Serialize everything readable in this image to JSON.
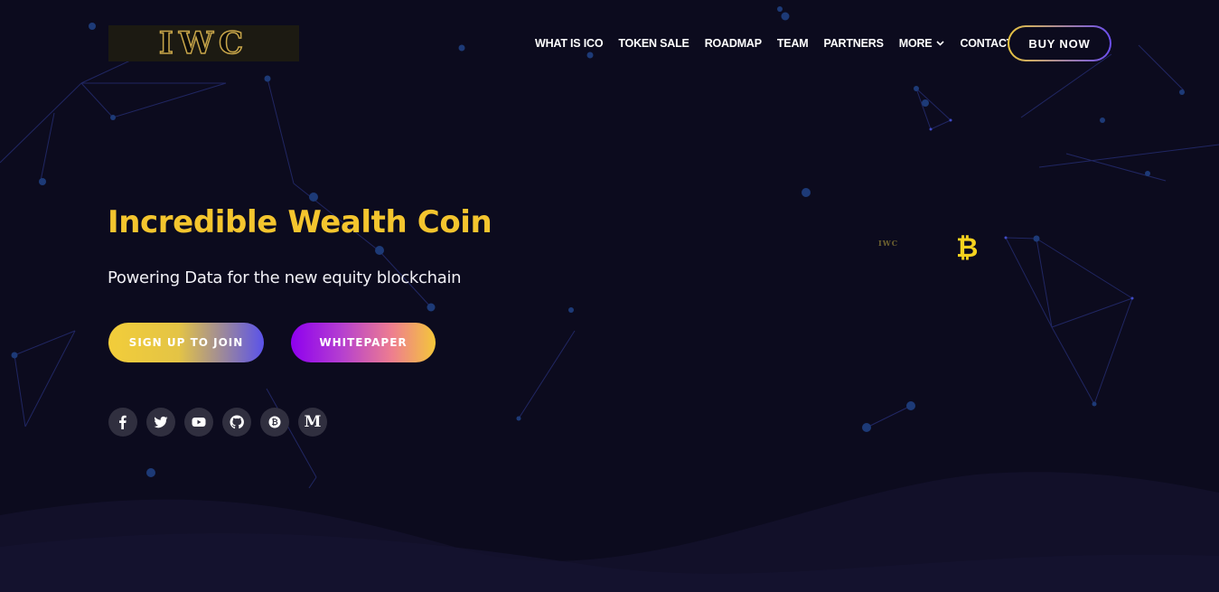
{
  "brand": {
    "logo_text": "IWC",
    "mini_logo_text": "IWC"
  },
  "nav": {
    "items": [
      {
        "label": "WHAT IS ICO"
      },
      {
        "label": "TOKEN SALE"
      },
      {
        "label": "ROADMAP"
      },
      {
        "label": "TEAM"
      },
      {
        "label": "PARTNERS"
      },
      {
        "label": "MORE",
        "has_dropdown": true
      },
      {
        "label": "CONTACT"
      }
    ],
    "buy_label": "BUY NOW"
  },
  "hero": {
    "title": "Incredible Wealth Coin",
    "subtitle": "Powering Data for the new equity blockchain",
    "signup_label": "SIGN UP TO JOIN",
    "whitepaper_label": "WHITEPAPER"
  },
  "socials": [
    {
      "icon": "facebook-icon"
    },
    {
      "icon": "twitter-icon"
    },
    {
      "icon": "youtube-icon"
    },
    {
      "icon": "github-icon"
    },
    {
      "icon": "bitcoin-icon"
    },
    {
      "icon": "medium-icon",
      "glyph": "M"
    }
  ],
  "bitcoin_glyph": "₿",
  "colors": {
    "background": "#0c0b1e",
    "accent_gold": "#f4c52e",
    "accent_purple": "#8e00ef",
    "accent_blue": "#5a52ea"
  }
}
